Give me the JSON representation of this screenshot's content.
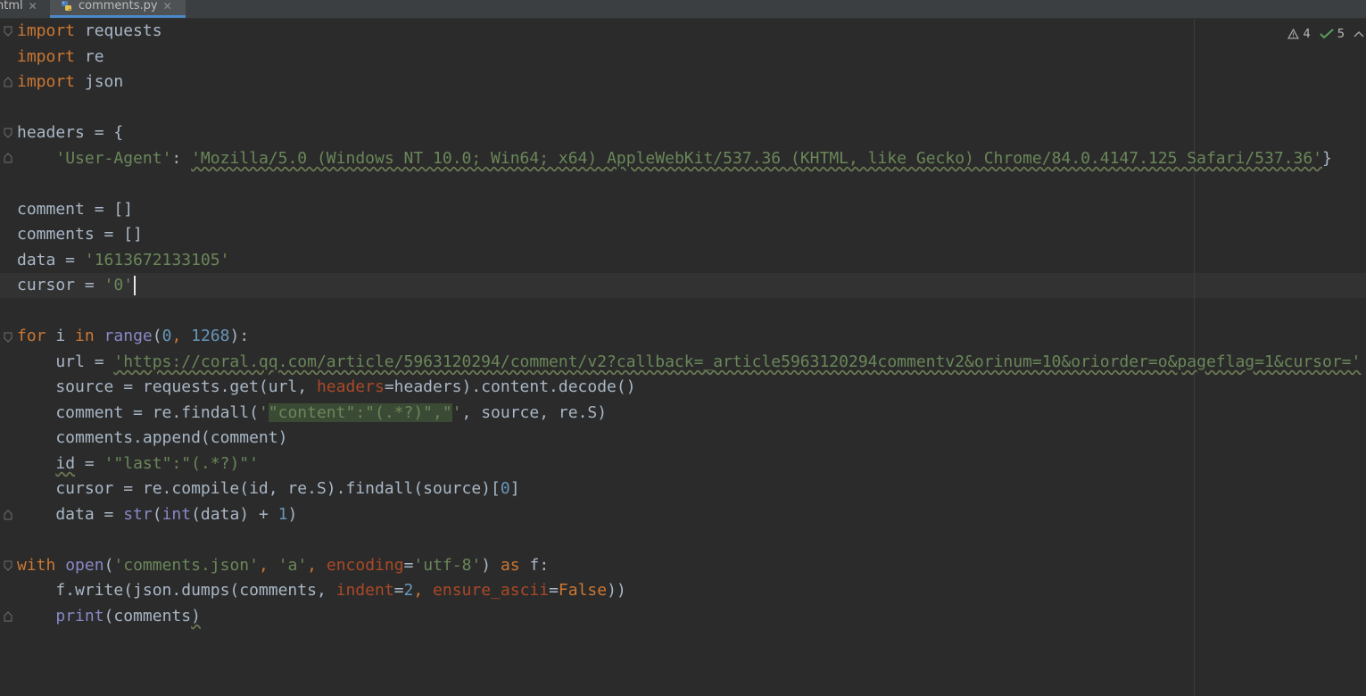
{
  "tabs": [
    {
      "label": "html",
      "active": false
    },
    {
      "label": "comments.py",
      "active": true
    }
  ],
  "inspections": {
    "warnings": "4",
    "weak_warnings": "5"
  },
  "code": {
    "l1_kw": "import",
    "l1_mod": " requests",
    "l2_kw": "import",
    "l2_mod": " re",
    "l3_kw": "import",
    "l3_mod": " json",
    "l5": "headers = {",
    "l6_key": "'User-Agent'",
    "l6_colon": ": ",
    "l6_val": "'Mozilla/5.0 (Windows NT 10.0; Win64; x64) AppleWebKit/537.36 (KHTML, like Gecko) Chrome/84.0.4147.125 Safari/537.36'",
    "l6_end": "}",
    "l8": "comment = []",
    "l9": "comments = []",
    "l10_a": "data = ",
    "l10_str": "'1613672133105'",
    "l11_a": "cursor = ",
    "l11_str": "'0'",
    "l13_for": "for",
    "l13_i": " i ",
    "l13_in": "in",
    "l13_sp": " ",
    "l13_range": "range",
    "l13_p1": "(",
    "l13_n1": "0",
    "l13_comma": ", ",
    "l13_n2": "1268",
    "l13_p2": "):",
    "l14_a": "    url = ",
    "l14_str": "'https://coral.qq.com/article/5963120294/comment/v2?callback=_article5963120294commentv2&orinum=10&oriorder=o&pageflag=1&cursor='",
    "l15_a": "    source = requests.get(url, ",
    "l15_param": "headers",
    "l15_b": "=headers).content.decode()",
    "l16_a": "    comment = re.findall(",
    "l16_q1": "'",
    "l16_hl": "\"content\":\"(.*?)\",\"",
    "l16_q2": "'",
    "l16_b": ", source, re.S)",
    "l17": "    comments.append(comment)",
    "l18_indent": "    ",
    "l18_id": "id",
    "l18_eq": " = ",
    "l18_str": "'\"last\":\"(.*?)\"'",
    "l19_a": "    cursor = re.compile(id, re.S).findall(source)[",
    "l19_n": "0",
    "l19_b": "]",
    "l20_a": "    data = ",
    "l20_str": "str",
    "l20_b": "(",
    "l20_int": "int",
    "l20_c": "(data) + ",
    "l20_n": "1",
    "l20_d": ")",
    "l22_with": "with",
    "l22_sp": " ",
    "l22_open": "open",
    "l22_a": "(",
    "l22_s1": "'comments.json'",
    "l22_c1": ", ",
    "l22_s2": "'a'",
    "l22_c2": ", ",
    "l22_param": "encoding",
    "l22_eq": "=",
    "l22_s3": "'utf-8'",
    "l22_b": ") ",
    "l22_as": "as",
    "l22_f": " f:",
    "l23_a": "    f.write(json.dumps(comments, ",
    "l23_p1": "indent",
    "l23_eq1": "=",
    "l23_n": "2",
    "l23_c": ", ",
    "l23_p2": "ensure_ascii",
    "l23_eq2": "=",
    "l23_false": "False",
    "l23_b": "))",
    "l24_indent": "    ",
    "l24_print": "print",
    "l24_a": "(comments",
    "l24_b": ")"
  }
}
